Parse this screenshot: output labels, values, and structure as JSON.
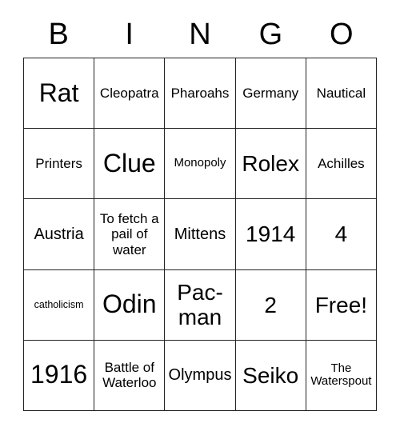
{
  "card": {
    "title": "BINGO",
    "header_letters": [
      "B",
      "I",
      "N",
      "G",
      "O"
    ],
    "free_space_label": "Free!",
    "colors": {
      "background": "#ffffff",
      "text": "#000000",
      "grid_line": "#222222"
    },
    "grid": {
      "rows": 5,
      "columns": 5,
      "cells": [
        [
          {
            "text": "Rat",
            "size": "fs-xl"
          },
          {
            "text": "Cleopatra",
            "size": "fs-sm"
          },
          {
            "text": "Pharoahs",
            "size": "fs-sm"
          },
          {
            "text": "Germany",
            "size": "fs-sm"
          },
          {
            "text": "Nautical",
            "size": "fs-sm"
          }
        ],
        [
          {
            "text": "Printers",
            "size": "fs-sm"
          },
          {
            "text": "Clue",
            "size": "fs-xl"
          },
          {
            "text": "Monopoly",
            "size": "fs-xs"
          },
          {
            "text": "Rolex",
            "size": "fs-lg"
          },
          {
            "text": "Achilles",
            "size": "fs-sm"
          }
        ],
        [
          {
            "text": "Austria",
            "size": "fs-md"
          },
          {
            "text": "To fetch a pail of water",
            "size": "fs-sm"
          },
          {
            "text": "Mittens",
            "size": "fs-md"
          },
          {
            "text": "1914",
            "size": "fs-lg"
          },
          {
            "text": "4",
            "size": "fs-lg"
          }
        ],
        [
          {
            "text": "catholicism",
            "size": "fs-xxs"
          },
          {
            "text": "Odin",
            "size": "fs-xl"
          },
          {
            "text": "Pac-man",
            "size": "fs-lg"
          },
          {
            "text": "2",
            "size": "fs-lg"
          },
          {
            "text": "Free!",
            "size": "fs-lg"
          }
        ],
        [
          {
            "text": "1916",
            "size": "fs-xl"
          },
          {
            "text": "Battle of Waterloo",
            "size": "fs-sm"
          },
          {
            "text": "Olympus",
            "size": "fs-md"
          },
          {
            "text": "Seiko",
            "size": "fs-lg"
          },
          {
            "text": "The Waterspout",
            "size": "fs-xs"
          }
        ]
      ]
    }
  }
}
